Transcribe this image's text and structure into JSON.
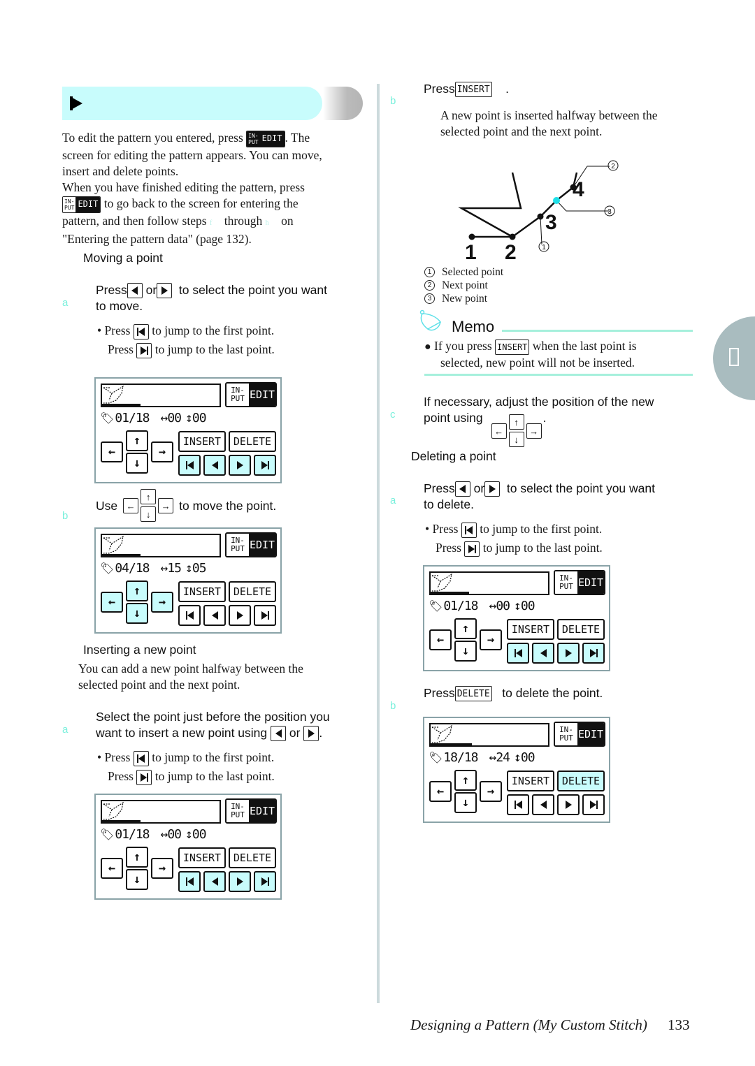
{
  "intro": {
    "line1_pre": "To edit the pattern you entered, press",
    "line1_post": ". The",
    "line2": "screen for editing the pattern appears. You can move,",
    "line3": "insert and delete points.",
    "line4": "When you have finished editing the pattern, press",
    "line5_post": "to go back to the screen for entering the",
    "line6": "pattern, and then follow steps",
    "line6_mid": "through",
    "line6_end": "on",
    "line7": "\"Entering the pattern data\" (page 132).",
    "step_ref_from": "f",
    "step_ref_to": "h"
  },
  "keys": {
    "in": "IN-",
    "put": "PUT",
    "edit": "EDIT",
    "insert": "INSERT",
    "delete": "DELETE"
  },
  "moving": {
    "heading": "Moving a point",
    "step_a_letter": "a",
    "step_a_pre": "Press",
    "step_a_or": "or",
    "step_a_post": "to select the point you want",
    "step_a_line2": "to move.",
    "bullet_first_pre": "Press",
    "bullet_first_post": "to jump to the first point.",
    "bullet_last_pre": "Press",
    "bullet_last_post": "to jump to the last point.",
    "step_b_letter": "b",
    "step_b_pre": "Use",
    "step_b_post": "to move the point."
  },
  "inserting": {
    "heading": "Inserting a new point",
    "desc_line1": "You can add a new point halfway between the",
    "desc_line2": "selected point and the next point.",
    "step_a_letter": "a",
    "step_a_line1": "Select the point just before the position you",
    "step_a_line2_pre": "want to insert a new point using",
    "step_a_or": "or",
    "step_a_end": ".",
    "bullet_first_pre": "Press",
    "bullet_first_post": "to jump to the first point.",
    "bullet_last_pre": "Press",
    "bullet_last_post": "to jump to the last point.",
    "step_b_letter": "b",
    "step_b_pre": "Press",
    "step_b_post": ".",
    "step_b_desc1": "A new point is inserted halfway between the",
    "step_b_desc2": "selected point and the next point.",
    "step_c_letter": "c",
    "step_c_line1": "If necessary, adjust the position of the new",
    "step_c_line2": "point using",
    "step_c_end": "."
  },
  "diagram": {
    "point_labels": [
      "1",
      "2",
      "3",
      "4"
    ],
    "callouts": [
      "1",
      "2",
      "3"
    ],
    "legend": [
      {
        "num": "1",
        "label": "Selected point"
      },
      {
        "num": "2",
        "label": "Next point"
      },
      {
        "num": "3",
        "label": "New point"
      }
    ],
    "new_point_color": "#20e0e8"
  },
  "memo": {
    "title": "Memo",
    "line1_pre": "If you press",
    "line1_post": "when the last point is",
    "line2": "selected, new point will not be inserted."
  },
  "deleting": {
    "heading": "Deleting a point",
    "step_a_letter": "a",
    "step_a_pre": "Press",
    "step_a_or": "or",
    "step_a_post": "to select the point you want",
    "step_a_line2": "to delete.",
    "bullet_first_pre": "Press",
    "bullet_first_post": "to jump to the first point.",
    "bullet_last_pre": "Press",
    "bullet_last_post": "to jump to the last point.",
    "step_b_letter": "b",
    "step_b_pre": "Press",
    "step_b_post": "to delete the point."
  },
  "screens": [
    {
      "counter": "01/18",
      "h": "00",
      "v": "00",
      "progress": 0.33
    },
    {
      "counter": "04/18",
      "h": "15",
      "v": "05",
      "progress": 0.33
    },
    {
      "counter": "01/18",
      "h": "00",
      "v": "00",
      "progress": 0.33
    },
    {
      "counter": "01/18",
      "h": "00",
      "v": "00",
      "progress": 0.33
    },
    {
      "counter": "18/18",
      "h": "24",
      "v": "00",
      "progress": 0.35
    }
  ],
  "colors": {
    "accent_cyan": "#c8fcfc",
    "step_letter": "#7af0dc",
    "side_tab": "#a9bcbf"
  },
  "footer": {
    "title": "Designing a Pattern (My Custom Stitch)",
    "page": "133"
  }
}
